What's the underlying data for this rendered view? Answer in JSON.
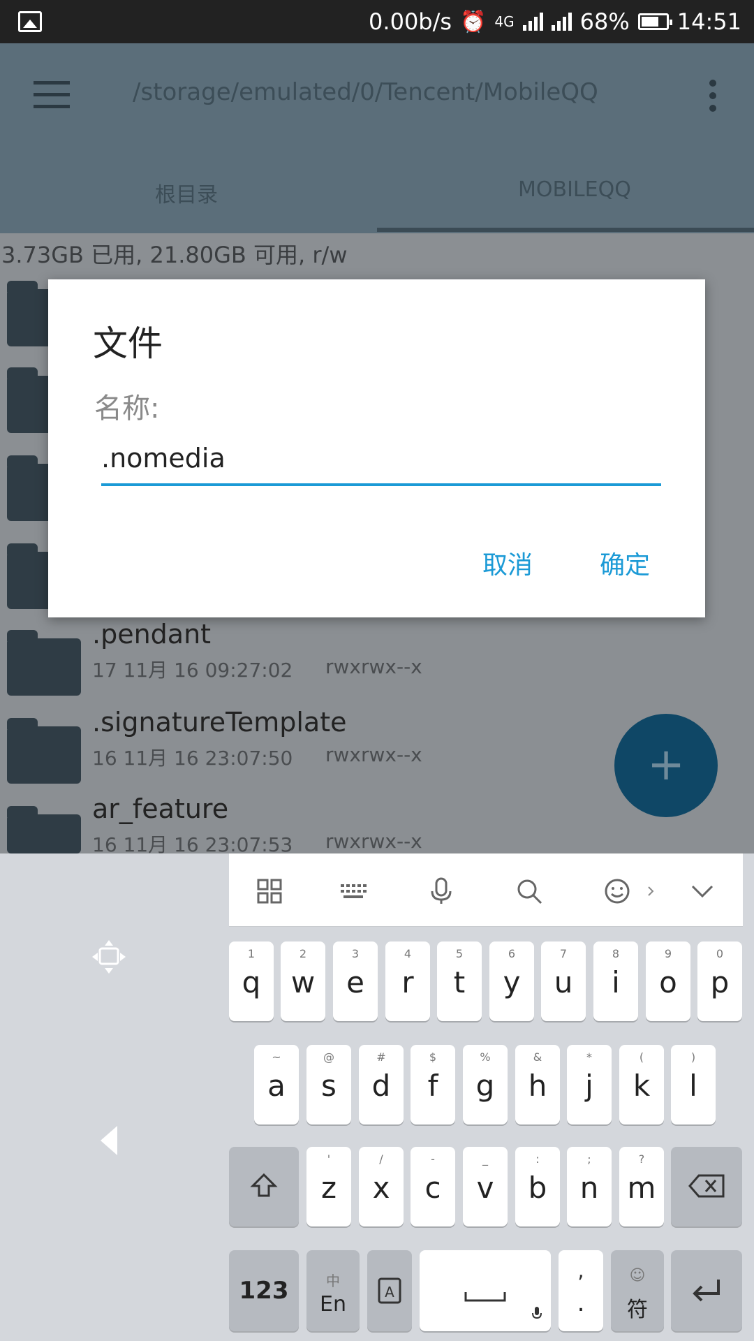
{
  "status_bar": {
    "speed": "0.00b/s",
    "network": "4G",
    "battery": "68%",
    "time": "14:51"
  },
  "app_bar": {
    "path": "/storage/emulated/0/Tencent/MobileQQ",
    "tabs": [
      {
        "label": "根目录"
      },
      {
        "label": "MOBILEQQ"
      }
    ]
  },
  "storage_info": "3.73GB 已用, 21.80GB 可用, r/w",
  "files": [
    {
      "name": ".pendant",
      "meta": "17 11月 16 09:27:02",
      "perms": "rwxrwx--x"
    },
    {
      "name": ".signatureTemplate",
      "meta": "16 11月 16 23:07:50",
      "perms": "rwxrwx--x"
    },
    {
      "name": "ar_feature",
      "meta": "16 11月 16 23:07:53",
      "perms": "rwxrwx--x"
    }
  ],
  "fab": {
    "label": "+"
  },
  "dialog": {
    "title": "文件",
    "label": "名称:",
    "input_value": ".nomedia",
    "cancel": "取消",
    "confirm": "确定"
  },
  "keyboard": {
    "row1": [
      {
        "hint": "1",
        "key": "q"
      },
      {
        "hint": "2",
        "key": "w"
      },
      {
        "hint": "3",
        "key": "e"
      },
      {
        "hint": "4",
        "key": "r"
      },
      {
        "hint": "5",
        "key": "t"
      },
      {
        "hint": "6",
        "key": "y"
      },
      {
        "hint": "7",
        "key": "u"
      },
      {
        "hint": "8",
        "key": "i"
      },
      {
        "hint": "9",
        "key": "o"
      },
      {
        "hint": "0",
        "key": "p"
      }
    ],
    "row2": [
      {
        "hint": "~",
        "key": "a"
      },
      {
        "hint": "@",
        "key": "s"
      },
      {
        "hint": "#",
        "key": "d"
      },
      {
        "hint": "$",
        "key": "f"
      },
      {
        "hint": "%",
        "key": "g"
      },
      {
        "hint": "&",
        "key": "h"
      },
      {
        "hint": "*",
        "key": "j"
      },
      {
        "hint": "(",
        "key": "k"
      },
      {
        "hint": ")",
        "key": "l"
      }
    ],
    "row3": [
      {
        "hint": "'",
        "key": "z"
      },
      {
        "hint": "/",
        "key": "x"
      },
      {
        "hint": "-",
        "key": "c"
      },
      {
        "hint": "_",
        "key": "v"
      },
      {
        "hint": ":",
        "key": "b"
      },
      {
        "hint": ";",
        "key": "n"
      },
      {
        "hint": "?",
        "key": "m"
      }
    ],
    "num_key": "123",
    "lang_hint": "中",
    "lang_key": "En",
    "comma_key": ",",
    "period_key": ".",
    "symbol_key": "符"
  }
}
